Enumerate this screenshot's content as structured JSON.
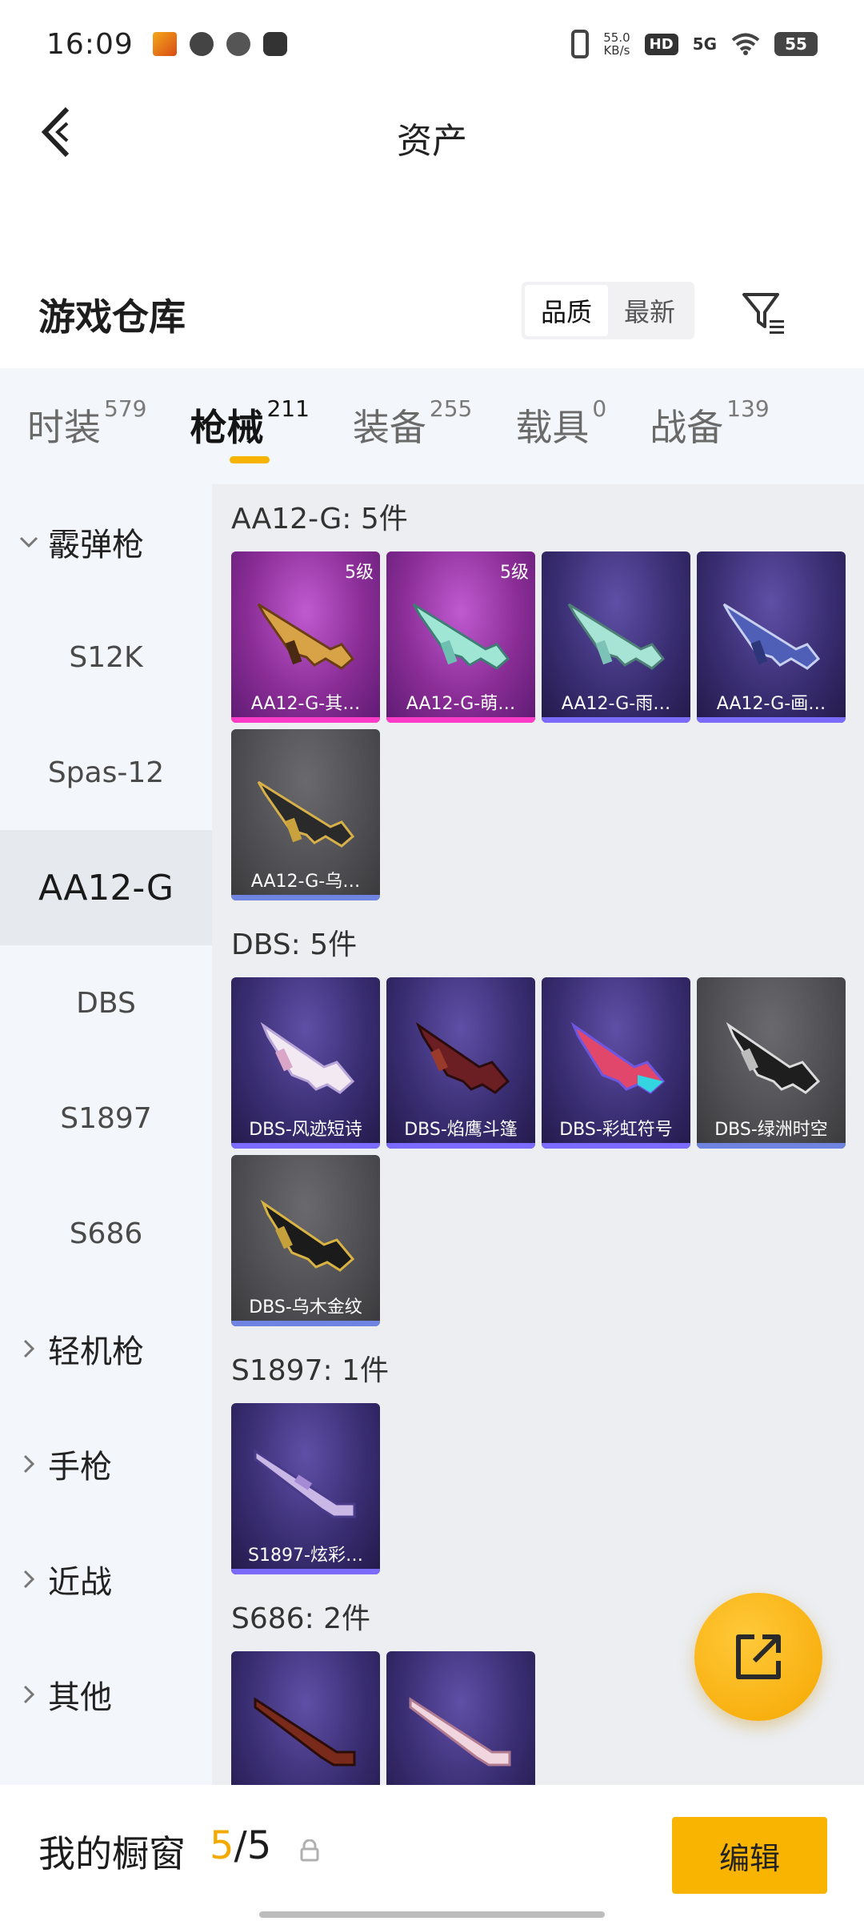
{
  "status_bar": {
    "time": "16:09",
    "net_speed_value": "55.0",
    "net_speed_unit": "KB/s",
    "hd": "HD",
    "signal": "5G",
    "battery": "55"
  },
  "header": {
    "title": "资产"
  },
  "warehouse": {
    "title": "游戏仓库",
    "sort_options": [
      "品质",
      "最新"
    ],
    "sort_active": "品质"
  },
  "tabs": [
    {
      "label": "时装",
      "count": "579"
    },
    {
      "label": "枪械",
      "count": "211",
      "active": true
    },
    {
      "label": "装备",
      "count": "255"
    },
    {
      "label": "载具",
      "count": "0"
    },
    {
      "label": "战备",
      "count": "139"
    }
  ],
  "sidebar": {
    "items": [
      {
        "label": "霰弹枪",
        "type": "group",
        "expanded": true
      },
      {
        "label": "S12K",
        "type": "sub"
      },
      {
        "label": "Spas-12",
        "type": "sub"
      },
      {
        "label": "AA12-G",
        "type": "sub",
        "selected": true
      },
      {
        "label": "DBS",
        "type": "sub"
      },
      {
        "label": "S1897",
        "type": "sub"
      },
      {
        "label": "S686",
        "type": "sub"
      },
      {
        "label": "轻机枪",
        "type": "group"
      },
      {
        "label": "手枪",
        "type": "group"
      },
      {
        "label": "近战",
        "type": "group"
      },
      {
        "label": "其他",
        "type": "group"
      }
    ]
  },
  "sections": [
    {
      "title": "AA12-G: 5件",
      "items": [
        {
          "name": "AA12-G-其…",
          "level": "5级",
          "rarity": "pink"
        },
        {
          "name": "AA12-G-萌…",
          "level": "5级",
          "rarity": "pink"
        },
        {
          "name": "AA12-G-雨…",
          "rarity": "purple"
        },
        {
          "name": "AA12-G-画…",
          "rarity": "purple"
        },
        {
          "name": "AA12-G-乌…",
          "rarity": "gray"
        }
      ]
    },
    {
      "title": "DBS: 5件",
      "items": [
        {
          "name": "DBS-风迹短诗",
          "rarity": "purple"
        },
        {
          "name": "DBS-焰鹰斗篷",
          "rarity": "purple"
        },
        {
          "name": "DBS-彩虹符号",
          "rarity": "purple"
        },
        {
          "name": "DBS-绿洲时空",
          "rarity": "gray"
        },
        {
          "name": "DBS-乌木金纹",
          "rarity": "gray"
        }
      ]
    },
    {
      "title": "S1897: 1件",
      "items": [
        {
          "name": "S1897-炫彩…",
          "rarity": "purple"
        }
      ]
    },
    {
      "title": "S686: 2件",
      "items": [
        {
          "name": "",
          "rarity": "purple"
        },
        {
          "name": "",
          "rarity": "purple"
        }
      ]
    }
  ],
  "showcase": {
    "label": "我的橱窗",
    "current": "5",
    "separator": "/",
    "total": "5",
    "edit_label": "编辑"
  },
  "colors": {
    "accent": "#f8b400",
    "rarity_pink": "#ff3cc8",
    "rarity_purple": "#7b6cff",
    "rarity_gray": "#6e84e0"
  }
}
